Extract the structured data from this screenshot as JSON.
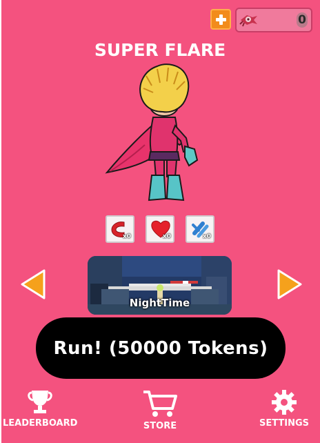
{
  "header": {
    "token_count": "0"
  },
  "character": {
    "name": "SUPER FLARE"
  },
  "powerups": [
    {
      "name": "magnet",
      "count": "x0"
    },
    {
      "name": "heart",
      "count": "x0"
    },
    {
      "name": "double-magnet",
      "count": "x0"
    }
  ],
  "level": {
    "name": "NightTime"
  },
  "run_button": {
    "label": "Run! (50000 Tokens)"
  },
  "nav": {
    "leaderboard": "LEADERBOARD",
    "store": "STORE",
    "settings": "SETTINGS"
  },
  "colors": {
    "background": "#f4527f",
    "accent_orange": "#f28c1c",
    "arrow_orange": "#f5a11c",
    "run_button": "#000000"
  },
  "icons": [
    "plus-icon",
    "token-icon",
    "magnet-icon",
    "heart-icon",
    "double-magnet-icon",
    "arrow-left-icon",
    "arrow-right-icon",
    "trophy-icon",
    "cart-icon",
    "gear-icon"
  ]
}
